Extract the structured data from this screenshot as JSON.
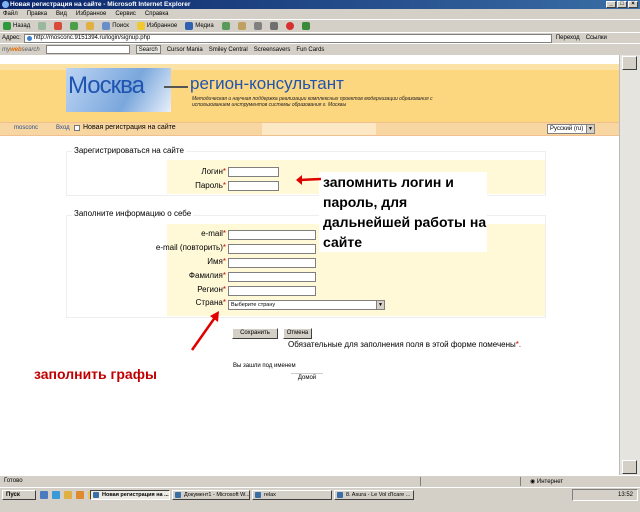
{
  "window": {
    "title": "Новая регистрация на сайте - Microsoft Internet Explorer",
    "controls": [
      "_",
      "□",
      "×"
    ]
  },
  "menu": [
    "Файл",
    "Правка",
    "Вид",
    "Избранное",
    "Сервис",
    "Справка"
  ],
  "toolbar": {
    "back": "Назад",
    "search": "Поиск",
    "favorites": "Избранное",
    "media": "Медиа"
  },
  "address": {
    "label": "Адрес:",
    "url": "http://mosconc.9151394.ru/login/signup.php",
    "go": "Переход",
    "links": "Ссылки"
  },
  "searchbar": {
    "logo_prefix": "my",
    "logo_brand": "web",
    "logo_suffix": "search",
    "search_button": "Search",
    "items": [
      "Cursor Mania",
      "Smiley Central",
      "Screensavers",
      "Fun Cards"
    ]
  },
  "banner": {
    "logo_text": "Москва",
    "title": "регион-консультант",
    "subtitle": "Методическая и научная поддержка реализации комплексных проектов модернизации образования с использованием инструментов системы образования г. Москвы"
  },
  "nav": {
    "site": "mosconc",
    "home": "Вход",
    "current": "Новая регистрация на сайте",
    "language": "Русский (ru)"
  },
  "login_section": {
    "legend": "Зарегистрироваться на сайте",
    "fields": [
      {
        "label": "Логин",
        "required": "*"
      },
      {
        "label": "Пароль",
        "required": "*"
      }
    ]
  },
  "info_section": {
    "legend": "Заполните информацию о себе",
    "fields": [
      {
        "label": "e-mail",
        "required": "*"
      },
      {
        "label": "e-mail (повторить)",
        "required": "*"
      },
      {
        "label": "Имя",
        "required": "*"
      },
      {
        "label": "Фамилия",
        "required": "*"
      },
      {
        "label": "Регион",
        "required": "*"
      },
      {
        "label": "Страна",
        "required": "*"
      }
    ],
    "country_placeholder": "Выберите страну"
  },
  "actions": {
    "save": "Сохранить",
    "cancel": "Отмена",
    "required_note": "Обязательные для заполнения поля в этой форме помечены",
    "required_mark": "*."
  },
  "footer": {
    "logged_in": "Вы зашли под именем",
    "home": "Домой"
  },
  "annotations": {
    "login_hint": "запомнить логин и пароль, для дальнейшей работы на сайте",
    "fill_hint": "заполнить графы",
    "arrow_color": "#e00000"
  },
  "status": {
    "text": "Готово",
    "zone": "Интернет"
  },
  "taskbar": {
    "start": "Пуск",
    "tasks": [
      "Новая регистрация на ...",
      "Документ1 - Microsoft W...",
      "relax",
      "8. Asura - Le Vol d'Icare ..."
    ],
    "clock": "13:52"
  }
}
